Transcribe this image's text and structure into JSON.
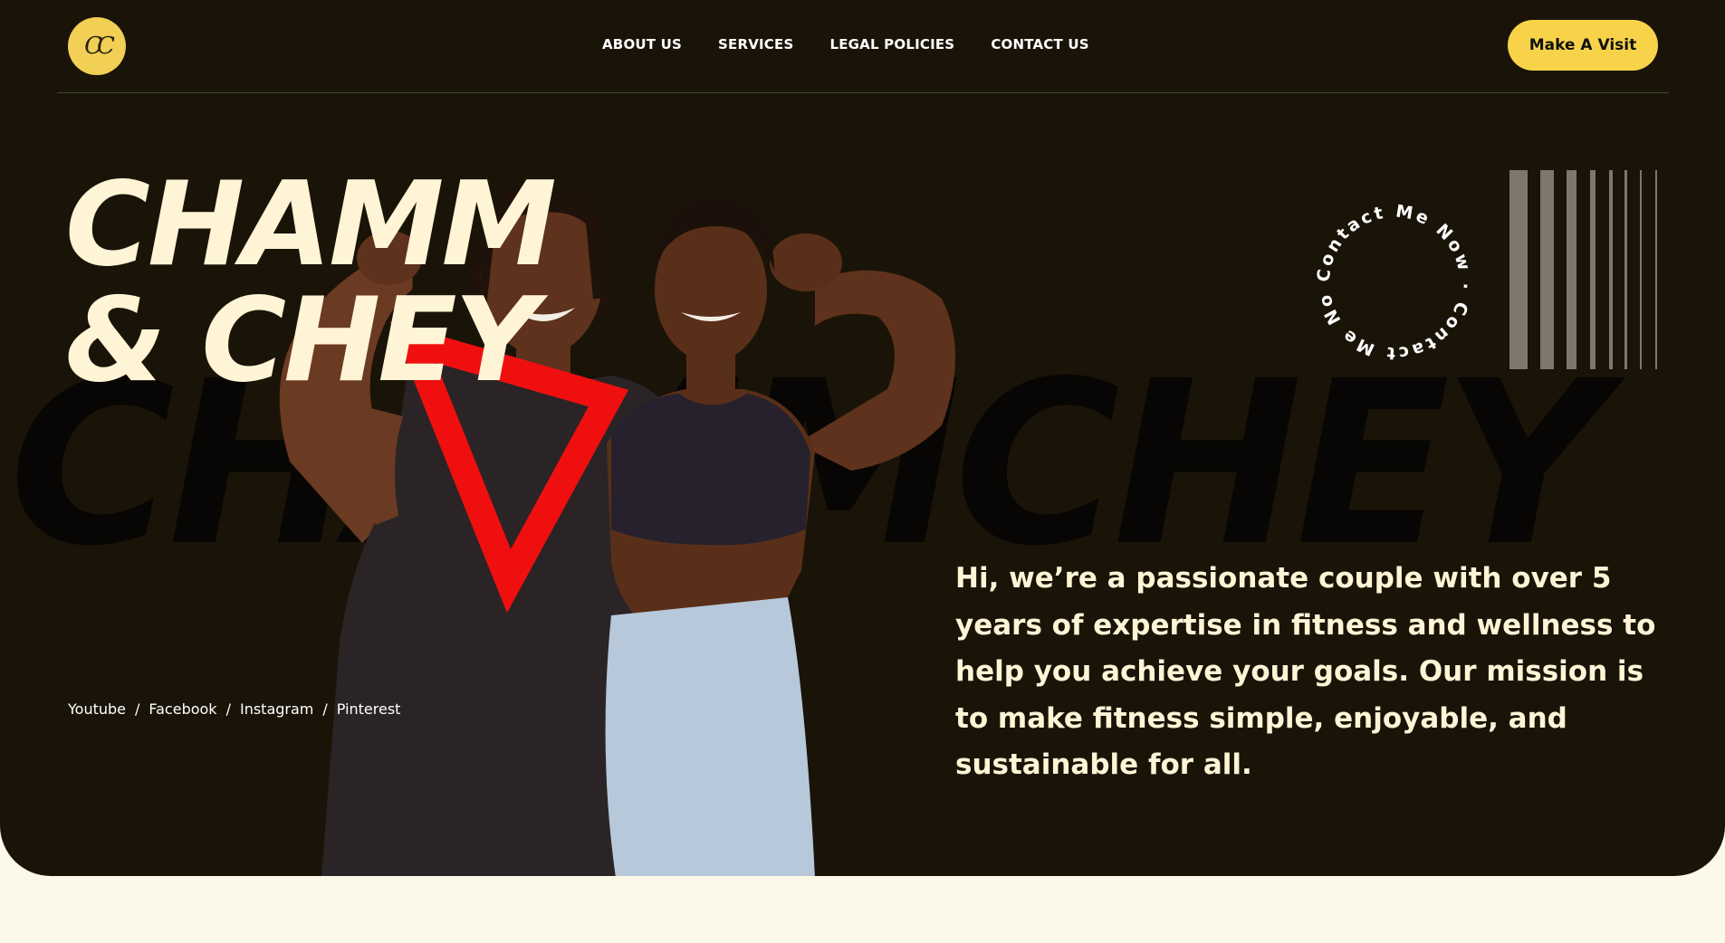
{
  "brand": {
    "logo_text": "CC",
    "logo_color": "#F2CF55"
  },
  "nav": {
    "items": [
      {
        "label": "ABOUT US"
      },
      {
        "label": "SERVICES"
      },
      {
        "label": "LEGAL POLICIES"
      },
      {
        "label": "CONTACT US"
      }
    ]
  },
  "header": {
    "cta_label": "Make A Visit",
    "cta_color": "#F8D34A"
  },
  "hero": {
    "title_line1": "CHAMM",
    "title_line2": "& CHEY",
    "background_text": "CHAMMCHEY",
    "intro": "Hi, we’re a passionate couple with over 5 years of expertise in fitness and wellness to help you achieve your goals. Our mission is to make fitness simple, enjoyable, and sustainable for all.",
    "contact_ring_text": "Contact Me Now · Contact Me Now ·",
    "background_color": "#1A1408",
    "title_color": "#FFF4D6"
  },
  "social": {
    "links": [
      {
        "label": "Youtube"
      },
      {
        "label": "Facebook"
      },
      {
        "label": "Instagram"
      },
      {
        "label": "Pinterest"
      }
    ],
    "separator": "/"
  }
}
